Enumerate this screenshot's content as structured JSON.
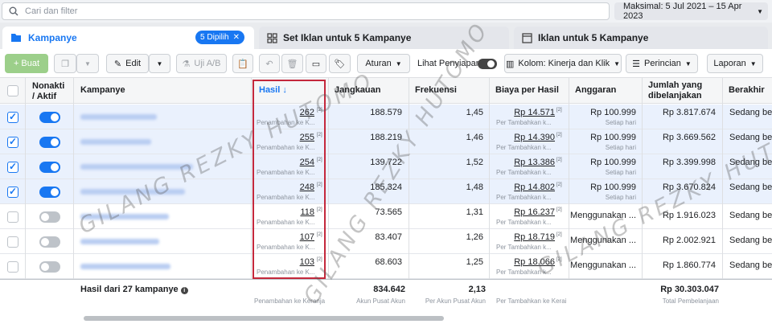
{
  "search": {
    "placeholder": "Cari dan filter"
  },
  "date_range": "Maksimal: 5 Jul 2021 – 15 Apr 2023",
  "tabs": {
    "campaigns": "Kampanye",
    "selected_badge": "5 Dipilih",
    "adsets": "Set Iklan untuk 5 Kampanye",
    "ads": "Iklan untuk 5 Kampanye"
  },
  "toolbar": {
    "create": "+ Buat",
    "edit": "Edit",
    "ab_test": "Uji A/B",
    "rules": "Aturan",
    "view_setup": "Lihat Penyiapan",
    "columns": "Kolom: Kinerja dan Klik",
    "breakdown": "Perincian",
    "reports": "Laporan"
  },
  "headers": {
    "off_on": "Nonakti / Aktif",
    "campaign": "Kampanye",
    "results": "Hasil ↓",
    "reach": "Jangkauan",
    "frequency": "Frekuensi",
    "cost_per_result": "Biaya per Hasil",
    "budget": "Anggaran",
    "amount_spent": "Jumlah yang dibelanjakan",
    "ends": "Berakhir"
  },
  "rows": [
    {
      "selected": true,
      "active": true,
      "results": "262",
      "results_sub": "Penambahan ke K...",
      "reach": "188.579",
      "freq": "1,45",
      "cpr": "Rp 14.571",
      "cpr_sub": "Per Tambahkan k...",
      "budget": "Rp 100.999",
      "budget_sub": "Setiap hari",
      "spent": "Rp 3.817.674",
      "ends": "Sedang ber"
    },
    {
      "selected": true,
      "active": true,
      "results": "255",
      "results_sub": "Penambahan ke K...",
      "reach": "188.219",
      "freq": "1,46",
      "cpr": "Rp 14.390",
      "cpr_sub": "Per Tambahkan k...",
      "budget": "Rp 100.999",
      "budget_sub": "Setiap hari",
      "spent": "Rp 3.669.562",
      "ends": "Sedang ber"
    },
    {
      "selected": true,
      "active": true,
      "results": "254",
      "results_sub": "Penambahan ke K...",
      "reach": "139.722",
      "freq": "1,52",
      "cpr": "Rp 13.386",
      "cpr_sub": "Per Tambahkan k...",
      "budget": "Rp 100.999",
      "budget_sub": "Setiap hari",
      "spent": "Rp 3.399.998",
      "ends": "Sedang ber"
    },
    {
      "selected": true,
      "active": true,
      "results": "248",
      "results_sub": "Penambahan ke K...",
      "reach": "185.324",
      "freq": "1,48",
      "cpr": "Rp 14.802",
      "cpr_sub": "Per Tambahkan k...",
      "budget": "Rp 100.999",
      "budget_sub": "Setiap hari",
      "spent": "Rp 3.670.824",
      "ends": "Sedang ber"
    },
    {
      "selected": false,
      "active": false,
      "results": "118",
      "results_sub": "Penambahan ke K...",
      "reach": "73.565",
      "freq": "1,31",
      "cpr": "Rp 16.237",
      "cpr_sub": "Per Tambahkan k...",
      "budget": "Menggunakan ...",
      "budget_sub": "",
      "spent": "Rp 1.916.023",
      "ends": "Sedang ber"
    },
    {
      "selected": false,
      "active": false,
      "results": "107",
      "results_sub": "Penambahan ke K...",
      "reach": "83.407",
      "freq": "1,26",
      "cpr": "Rp 18.719",
      "cpr_sub": "Per Tambahkan k...",
      "budget": "Menggunakan ...",
      "budget_sub": "",
      "spent": "Rp 2.002.921",
      "ends": "Sedang ber"
    },
    {
      "selected": false,
      "active": false,
      "results": "103",
      "results_sub": "Penambahan ke K...",
      "reach": "68.603",
      "freq": "1,25",
      "cpr": "Rp 18.066",
      "cpr_sub": "Per Tambahkan k...",
      "budget": "Menggunakan ...",
      "budget_sub": "",
      "spent": "Rp 1.860.774",
      "ends": "Sedang ber"
    }
  ],
  "footer": {
    "label": "Hasil dari 27 kampanye",
    "results_sub": "Penambahan ke Keranja",
    "reach": "834.642",
    "reach_sub": "Akun Pusat Akun",
    "freq": "2,13",
    "freq_sub": "Per Akun Pusat Akun",
    "cpr_sub": "Per Tambahkan ke Kerai",
    "spent": "Rp 30.303.047",
    "spent_sub": "Total Pembelanjaan"
  },
  "watermark": "GILANG REZKY HUTOMO",
  "colors": {
    "accent": "#1877f2",
    "highlight": "#c4283c",
    "selected_row": "#eaf1fd"
  }
}
